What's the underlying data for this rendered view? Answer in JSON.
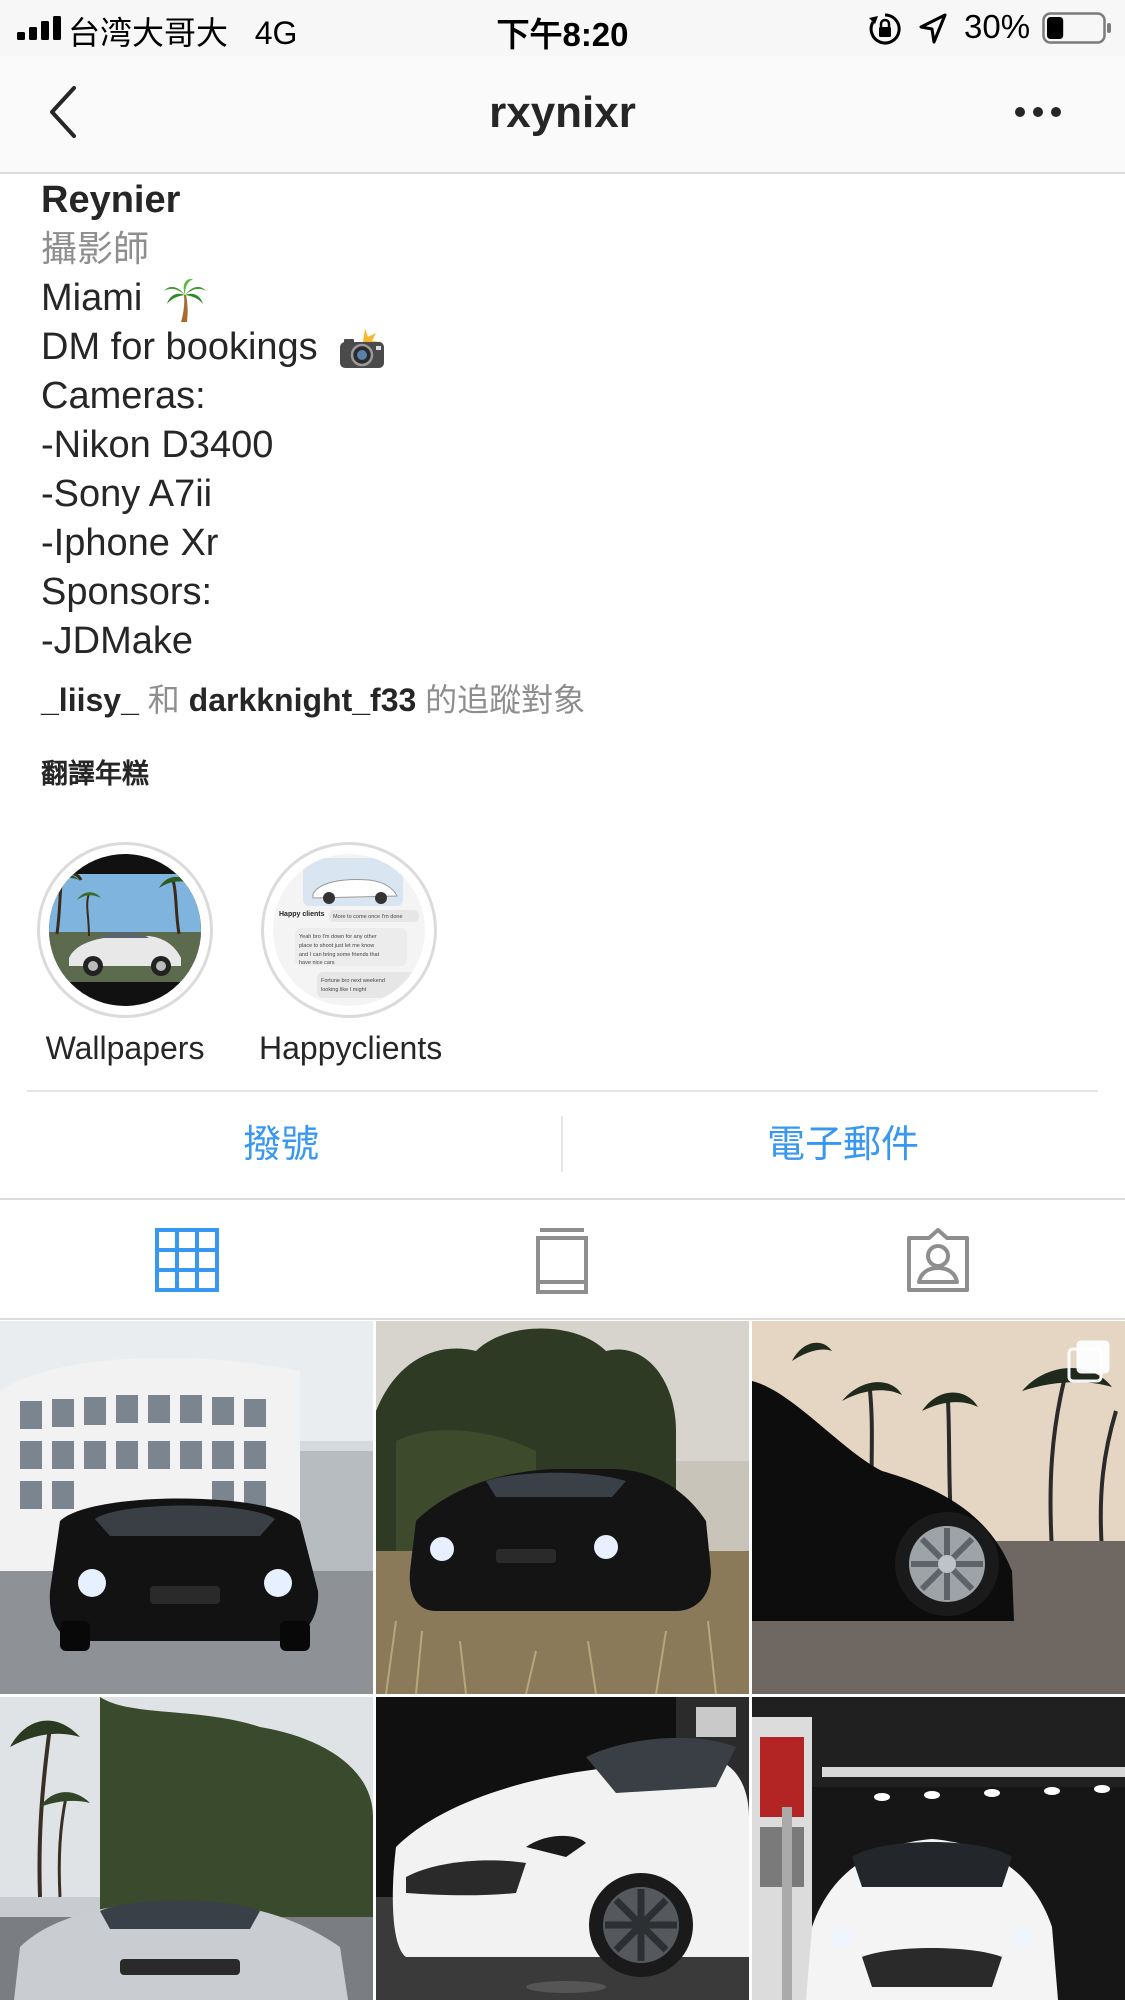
{
  "status_bar": {
    "carrier": "台湾大哥大",
    "network": "4G",
    "time": "下午8:20",
    "battery_percent": "30%",
    "battery_level": 0.3,
    "icons": [
      "signal-icon",
      "orientation-lock-icon",
      "location-arrow-icon",
      "battery-icon"
    ]
  },
  "header": {
    "username": "rxynixr",
    "back_icon": "chevron-left-icon",
    "more_icon": "more-horizontal-icon"
  },
  "bio": {
    "name": "Reynier",
    "category": "攝影師",
    "lines": [
      "Miami",
      "DM for bookings",
      "Cameras:",
      "-Nikon D3400",
      "-Sony A7ii",
      "-Iphone Xr",
      "Sponsors:",
      "-JDMake"
    ],
    "emojis": [
      "palm-tree-icon",
      "camera-flash-icon"
    ]
  },
  "followed_by": {
    "user1": "_liisy_",
    "conjunction": "和",
    "user2": "darkknight_f33",
    "suffix": "的追蹤對象"
  },
  "translate_label": "翻譯年糕",
  "highlights": [
    {
      "label": "Wallpapers"
    },
    {
      "label": "Happyclients",
      "preview_title": "Happy clients",
      "preview_lines": [
        "More to come once I'm done",
        "Yeah bro I'm down for any other place to shoot just let me know",
        "Fortune bro next weekend looking like I might"
      ]
    }
  ],
  "contact": {
    "call_label": "撥號",
    "email_label": "電子郵件"
  },
  "tabs": [
    {
      "name": "grid",
      "icon": "grid-icon",
      "active": true
    },
    {
      "name": "igtv",
      "icon": "igtv-icon",
      "active": false
    },
    {
      "name": "tagged",
      "icon": "tagged-person-icon",
      "active": false
    }
  ],
  "posts": [
    {
      "subject": "black-bmw-front-building"
    },
    {
      "subject": "black-bmw-grass-field"
    },
    {
      "subject": "black-car-wheel-palms",
      "multi": true
    },
    {
      "subject": "silver-car-trees"
    },
    {
      "subject": "white-infiniti-night"
    },
    {
      "subject": "white-infiniti-gas-station"
    }
  ],
  "colors": {
    "accent": "#3897f0",
    "muted": "#8e8e8e",
    "text": "#262626",
    "divider": "#dbdbdb"
  }
}
